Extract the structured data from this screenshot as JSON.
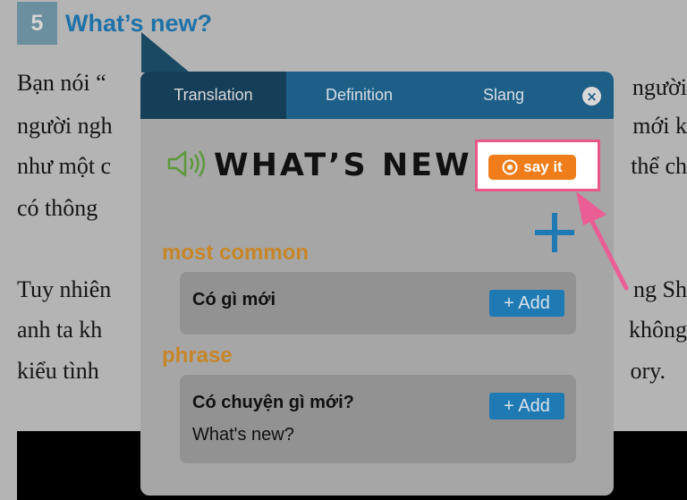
{
  "article": {
    "heading_number": "5",
    "heading_title": "What’s new?",
    "lines_left": [
      "Bạn nói “",
      "người ngh",
      "như một c",
      "có thông",
      "Tuy nhiên",
      "anh ta kh",
      "kiểu tình"
    ],
    "lines_right": [
      "người",
      "mới k",
      "thể ch",
      "ng Sh",
      "không",
      "ory."
    ]
  },
  "popup": {
    "tabs": [
      {
        "label": "Translation",
        "active": true
      },
      {
        "label": "Definition",
        "active": false
      },
      {
        "label": "Slang",
        "active": false
      }
    ],
    "close_icon": "×",
    "word": "WHAT’S NEW",
    "say_it_label": "say it",
    "sections": [
      {
        "label": "most common",
        "entries": [
          {
            "text": "Có gì mới",
            "sub": "",
            "add_label": "+ Add"
          }
        ]
      },
      {
        "label": "phrase",
        "entries": [
          {
            "text": "Có chuyện gì mới?",
            "sub": "What's new?",
            "add_label": "+ Add"
          }
        ]
      }
    ]
  },
  "colors": {
    "tab_bar": "#1d5f87",
    "tab_active": "#153f59",
    "say_it": "#ef7d1a",
    "highlight": "#e8568a",
    "section_label": "#c78628",
    "add_button": "#1f7ab4"
  },
  "icons": [
    "speaker-icon",
    "close-icon",
    "say-it-icon",
    "plus-icon",
    "arrow-pointer-icon"
  ]
}
